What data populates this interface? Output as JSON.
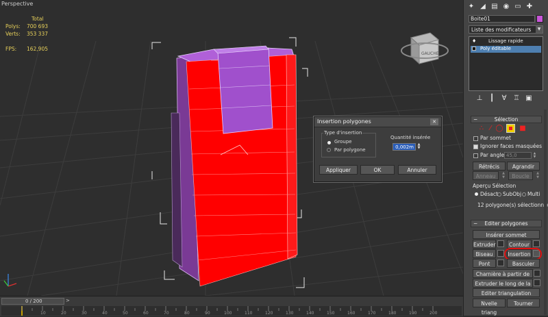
{
  "viewport": {
    "label": "Perspective",
    "stats": {
      "header": "Total",
      "rows": [
        {
          "key": "Polys:",
          "value": "700 693"
        },
        {
          "key": "Verts:",
          "value": "353 337"
        },
        {
          "key": "FPS:",
          "value": "162,905"
        }
      ]
    },
    "viewcube_label": "GAUCHE"
  },
  "dialog": {
    "title": "Insertion polygones",
    "type_group_label": "Type d'insertion",
    "option_group": "Groupe",
    "option_per_poly": "Par polygone",
    "amount_label": "Quantité insérée",
    "amount_value": "0,002m",
    "apply": "Appliquer",
    "ok": "OK",
    "cancel": "Annuler",
    "close": "✕"
  },
  "panel": {
    "object_name": "Boite01",
    "object_color": "#c855d8",
    "modifier_list": "Liste des modificateurs",
    "stack": [
      "Lissage rapide",
      "Poly éditable"
    ],
    "selection": {
      "title": "Sélection",
      "par_sommet": "Par sommet",
      "ignore_back": "Ignorer faces masquées",
      "par_angle": "Par angle :",
      "angle_value": "45,0",
      "shrink": "Rétrécis",
      "grow": "Agrandir",
      "ring": "Anneau",
      "loop": "Boucle",
      "preview_label": "Aperçu Sélection",
      "preview_off": "Désact",
      "preview_subobj": "SubObj",
      "preview_multi": "Multi",
      "status": "12 polygone(s) sélectionné(s)"
    },
    "edit_polys": {
      "title": "Editer polygones",
      "insert_vertex": "Insérer sommet",
      "extrude": "Extruder",
      "outline": "Contour",
      "bevel": "Biseau",
      "inset": "Insertion",
      "bridge": "Pont",
      "flip": "Basculer",
      "hinge": "Charnière à partir de l'arête",
      "extrude_spline": "Extruder le long de la spline",
      "edit_tri": "Editer triangulation",
      "retriangulate": "Nvelle triang",
      "turn": "Tourner"
    }
  },
  "timeline": {
    "frame": "0 / 200",
    "ticks": [
      "10",
      "20",
      "30",
      "40",
      "50",
      "60",
      "70",
      "80",
      "90",
      "100",
      "110",
      "120",
      "130",
      "140",
      "150",
      "160",
      "170",
      "180",
      "190",
      "200"
    ]
  },
  "colors": {
    "selected_face": "#ff0000",
    "mesh_purple": "#a450c8",
    "stats_text": "#e8d15a",
    "highlight_circle": "#e01010"
  }
}
